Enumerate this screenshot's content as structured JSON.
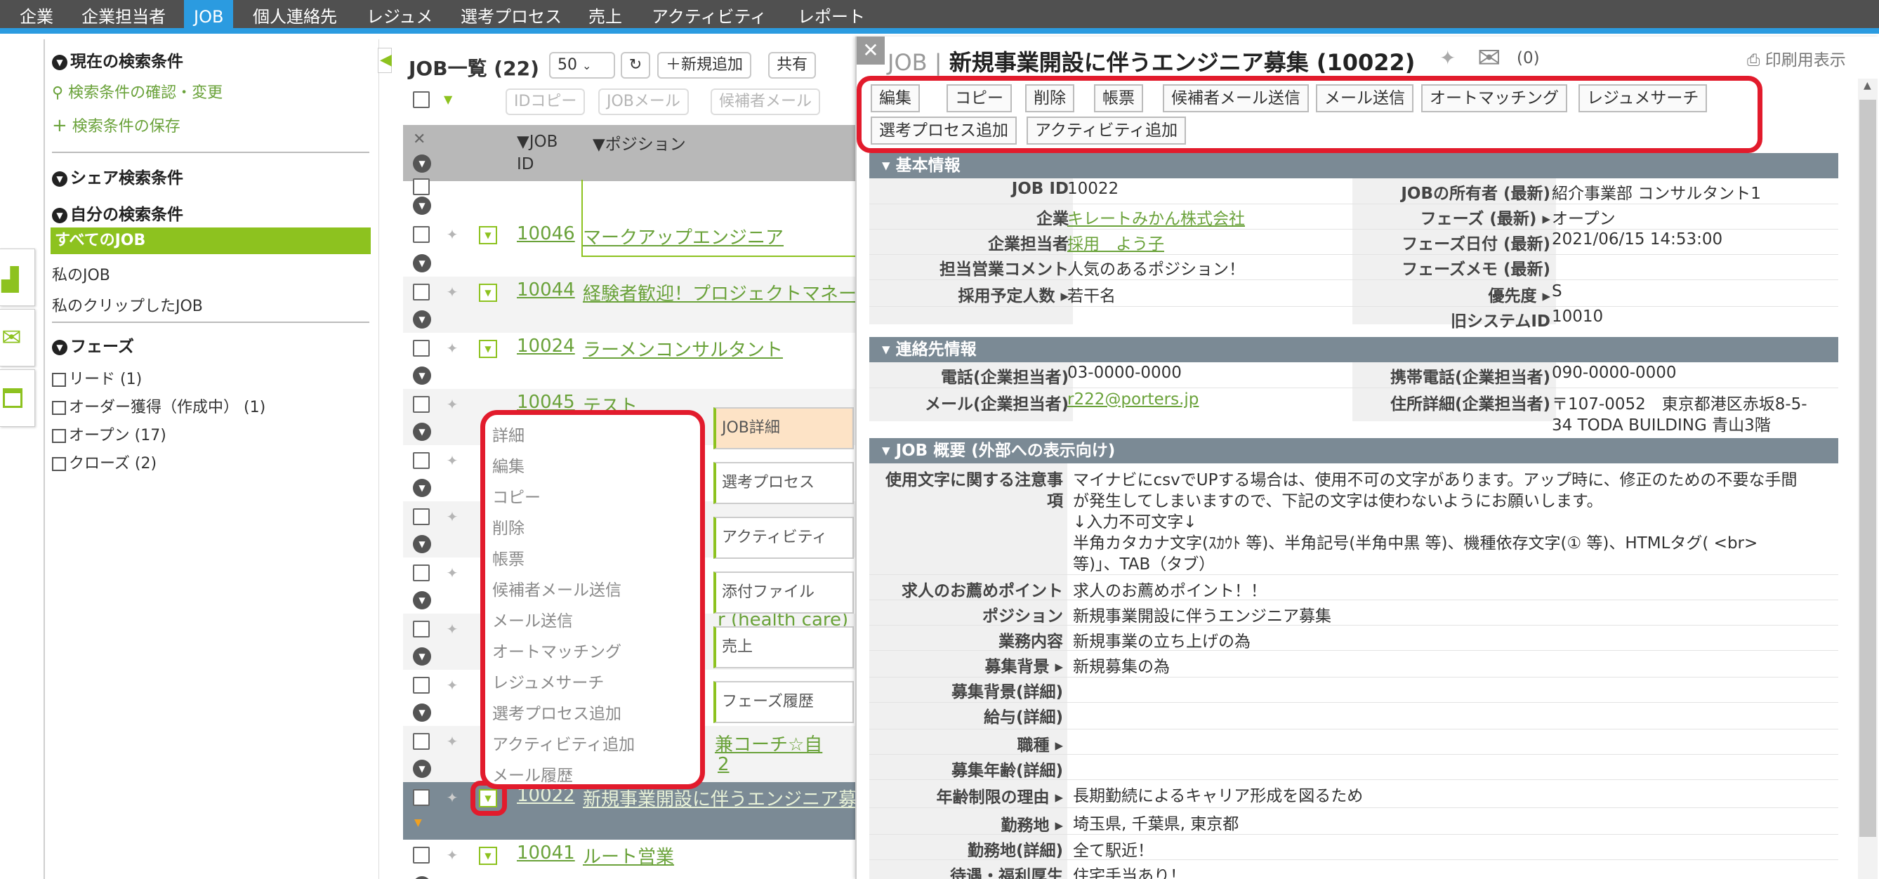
{
  "colors": {
    "accent": "#2b9be0",
    "brand_green": "#8dc21f",
    "highlight_red": "#e21b2c",
    "section_bar": "#7b8a95"
  },
  "nav": {
    "items": [
      "企業",
      "企業担当者",
      "JOB",
      "個人連絡先",
      "レジュメ",
      "選考プロセス",
      "売上",
      "アクティビティ",
      "レポート"
    ],
    "active": "JOB"
  },
  "sidebar": {
    "current_conditions": "現在の検索条件",
    "confirm_change": "検索条件の確認・変更",
    "save_conditions": "検索条件の保存",
    "shared_conditions": "シェア検索条件",
    "my_conditions": "自分の検索条件",
    "all_jobs": "すべてのJOB",
    "my_jobs": "私のJOB",
    "my_clipped": "私のクリップしたJOB",
    "phase_title": "フェーズ",
    "phases": [
      "リード (1)",
      "オーダー獲得（作成中） (1)",
      "オープン (17)",
      "クローズ (2)"
    ]
  },
  "list": {
    "title": "JOB一覧 (22)",
    "page_size": "50",
    "new_button": "＋新規追加",
    "share_button": "共有",
    "toolbar": {
      "id_copy": "IDコピー",
      "job_mail": "JOBメール",
      "candidate_mail": "候補者メール"
    },
    "columns": {
      "job_id": "▼JOB ID",
      "position": "▼ポジション"
    },
    "rows": [
      {
        "id": "10046",
        "position": "マークアップエンジニア"
      },
      {
        "id": "10044",
        "position": "経験者歓迎！プロジェクトマネー"
      },
      {
        "id": "10024",
        "position": "ラーメンコンサルタント"
      },
      {
        "id": "10045",
        "position": "テスト"
      },
      {
        "id": "10022",
        "position": "新規事業開設に伴うエンジニア募"
      },
      {
        "id": "10041",
        "position": "ルート営業"
      }
    ],
    "partial_texts": [
      "r (health care)",
      "兼コーチ☆自",
      "2"
    ]
  },
  "context_menu": {
    "items": [
      "詳細",
      "編集",
      "コピー",
      "削除",
      "帳票",
      "候補者メール送信",
      "メール送信",
      "オートマッチング",
      "レジュメサーチ",
      "選考プロセス追加",
      "アクティビティ追加",
      "メール履歴"
    ],
    "submenu": [
      "JOB詳細",
      "選考プロセス",
      "アクティビティ",
      "添付ファイル",
      "売上",
      "フェーズ履歴"
    ]
  },
  "detail": {
    "title_prefix": "JOB",
    "title": "新規事業開設に伴うエンジニア募集 (10022)",
    "mail_count": "(0)",
    "print": "印刷用表示",
    "actions": [
      "編集",
      "コピー",
      "削除",
      "帳票",
      "候補者メール送信",
      "メール送信",
      "オートマッチング",
      "レジュメサーチ",
      "選考プロセス追加",
      "アクティビティ追加"
    ],
    "sections": {
      "basic": "基本情報",
      "contact": "連絡先情報",
      "overview": "JOB 概要 (外部への表示向け)"
    },
    "basic": {
      "job_id_label": "JOB ID",
      "job_id": "10022",
      "owner_label": "JOBの所有者 (最新)",
      "owner": "紹介事業部 コンサルタント1",
      "company_label": "企業",
      "company": "キレートみかん株式会社",
      "phase_label": "フェーズ (最新) ▸",
      "phase": "オープン",
      "rep_label": "企業担当者",
      "rep": "採用　よう子",
      "phase_date_label": "フェーズ日付 (最新)",
      "phase_date": "2021/06/15 14:53:00",
      "comment_label": "担当営業コメント",
      "comment": "人気のあるポジション！",
      "phase_memo_label": "フェーズメモ (最新)",
      "hires_label": "採用予定人数 ▸",
      "hires": "若干名",
      "priority_label": "優先度 ▸",
      "priority": "S",
      "old_id_label": "旧システムID",
      "old_id": "10010"
    },
    "contact": {
      "phone_label": "電話(企業担当者)",
      "phone": "03-0000-0000",
      "mobile_label": "携帯電話(企業担当者)",
      "mobile": "090-0000-0000",
      "mail_label": "メール(企業担当者)",
      "mail": "r222@porters.jp",
      "address_label": "住所詳細(企業担当者)",
      "address_1": "〒107-0052　東京都港区赤坂8-5-",
      "address_2": "34 TODA BUILDING 青山3階"
    },
    "overview": {
      "notice_label_1": "使用文字に関する注意事",
      "notice_label_2": "項",
      "notice_1": "マイナビにcsvでUPする場合は、使用不可の文字があります。アップ時に、修正のための不要な手間",
      "notice_2": "が発生してしまいますので、下記の文字は使わないようにお願いします。",
      "notice_3": "↓入力不可文字↓",
      "notice_4": "半角カタカナ文字(ｽｶｳﾄ 等)、半角記号(半角中黒 等)、機種依存文字(① 等)、HTMLタグ( <br>",
      "notice_5": "等)」、TAB（タブ）",
      "recommend_label": "求人のお薦めポイント",
      "recommend": "求人のお薦めポイント！！",
      "position_label": "ポジション",
      "position": "新規事業開設に伴うエンジニア募集",
      "work_label": "業務内容",
      "work": "新規事業の立ち上げの為",
      "bg_label": "募集背景 ▸",
      "bg": "新規募集の為",
      "bg_detail_label": "募集背景(詳細)",
      "salary_label": "給与(詳細)",
      "jobtype_label": "職種 ▸",
      "age_label": "募集年齢(詳細)",
      "age_reason_label": "年齢制限の理由 ▸",
      "age_reason": "長期勤続によるキャリア形成を図るため",
      "location_label": "勤務地 ▸",
      "location": "埼玉県, 千葉県, 東京都",
      "location_detail_label": "勤務地(詳細)",
      "location_detail": "全て駅近！",
      "welfare_label": "待遇・福利厚生",
      "welfare": "住宅手当あり！"
    }
  }
}
